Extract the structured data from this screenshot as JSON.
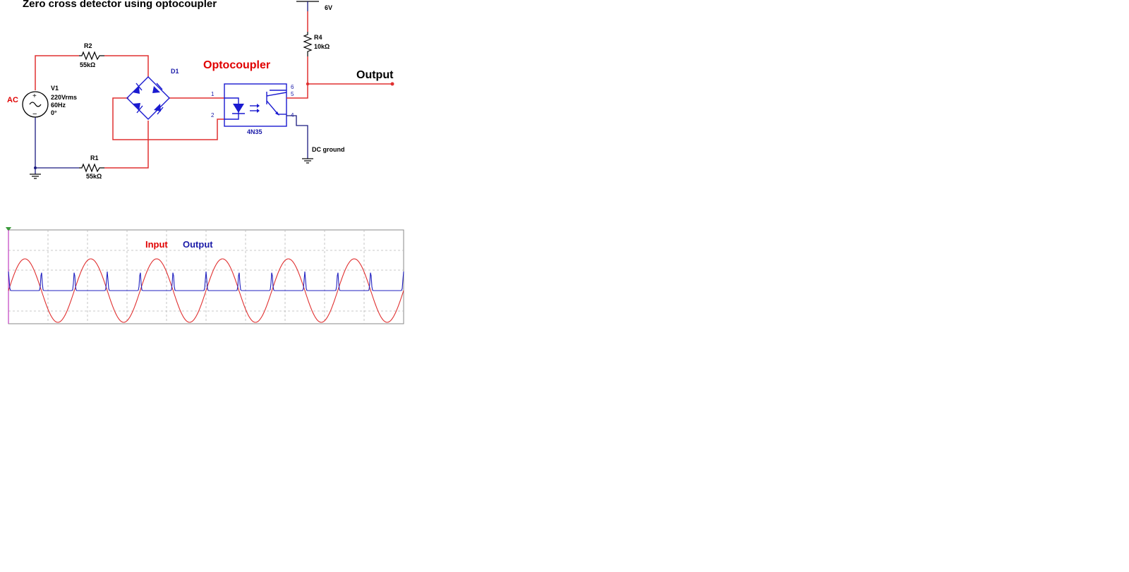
{
  "title": "Zero cross detector using optocoupler",
  "source": {
    "tag": "AC",
    "name": "V1",
    "voltage": "220Vrms",
    "frequency": "60Hz",
    "phase": "0°"
  },
  "resistors": {
    "r2": {
      "name": "R2",
      "value": "55kΩ"
    },
    "r1": {
      "name": "R1",
      "value": "55kΩ"
    },
    "r4": {
      "name": "R4",
      "value": "10kΩ"
    }
  },
  "bridge": {
    "name": "D1"
  },
  "optocoupler": {
    "heading": "Optocoupler",
    "part": "4N35",
    "pins": [
      "1",
      "2",
      "6",
      "5",
      "4"
    ]
  },
  "supply": {
    "value": "6V"
  },
  "output_label": "Output",
  "dc_ground_label": "DC ground",
  "scope": {
    "legend_input": "Input",
    "legend_output": "Output",
    "input_color": "#e03030",
    "output_color": "#2020c0",
    "cycles": 6
  }
}
